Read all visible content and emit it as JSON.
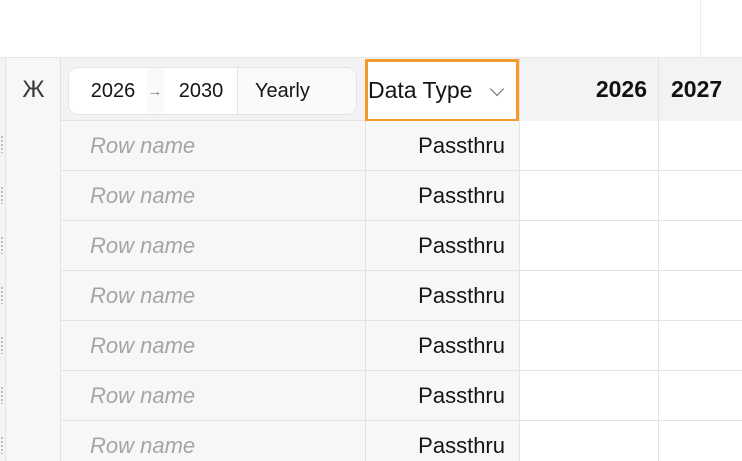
{
  "toolbar": {
    "formula_glyph": "Ж",
    "range_start": "2026",
    "range_arrow": "→",
    "range_end": "2030",
    "period": "Yearly"
  },
  "columns": {
    "data_type": "Data Type",
    "years": [
      "2026",
      "2027"
    ]
  },
  "rows": [
    {
      "name_placeholder": "Row name",
      "data_type": "Passthru"
    },
    {
      "name_placeholder": "Row name",
      "data_type": "Passthru"
    },
    {
      "name_placeholder": "Row name",
      "data_type": "Passthru"
    },
    {
      "name_placeholder": "Row name",
      "data_type": "Passthru"
    },
    {
      "name_placeholder": "Row name",
      "data_type": "Passthru"
    },
    {
      "name_placeholder": "Row name",
      "data_type": "Passthru"
    },
    {
      "name_placeholder": "Row name",
      "data_type": "Passthru"
    }
  ],
  "colors": {
    "selection_outline": "#f39a2e",
    "placeholder_text": "#a5a5a5",
    "header_bg": "#f3f3f3"
  }
}
